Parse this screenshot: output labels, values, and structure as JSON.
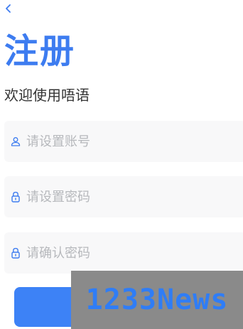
{
  "header": {
    "back_icon": "chevron-left-icon",
    "title": "注册",
    "subtitle": "欢迎使用唔语"
  },
  "form": {
    "account": {
      "icon": "user-icon",
      "placeholder": "请设置账号",
      "value": ""
    },
    "password": {
      "icon": "lock-icon",
      "placeholder": "请设置密码",
      "value": ""
    },
    "confirm_password": {
      "icon": "lock-icon",
      "placeholder": "请确认密码",
      "value": ""
    },
    "submit_label": ""
  },
  "watermark": {
    "text": "1233News"
  },
  "colors": {
    "accent": "#3d7cf0",
    "button": "#3d82f6",
    "field_bg": "#f8f8f9",
    "placeholder": "#b6b8bc",
    "icon": "#3d7cf0"
  }
}
